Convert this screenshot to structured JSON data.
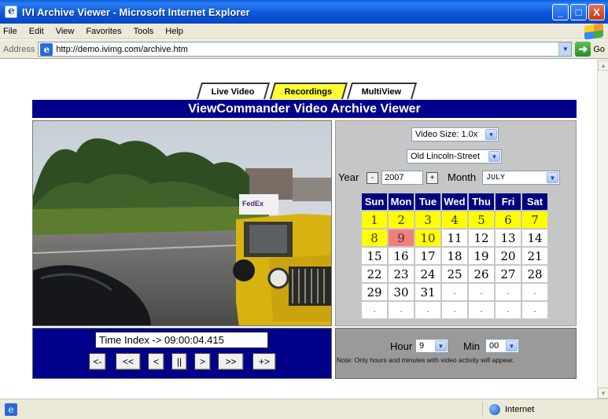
{
  "window": {
    "title": "IVI Archive Viewer - Microsoft Internet Explorer",
    "minimize_glyph": "_",
    "maximize_glyph": "□",
    "close_glyph": "X"
  },
  "menu": [
    "File",
    "Edit",
    "View",
    "Favorites",
    "Tools",
    "Help"
  ],
  "address": {
    "label": "Address",
    "url": "http://demo.ivimg.com/archive.htm",
    "go_label": "Go"
  },
  "status": {
    "zone": "Internet"
  },
  "tabs": [
    {
      "label": "Live Video",
      "active": false
    },
    {
      "label": "Recordings",
      "active": true
    },
    {
      "label": "MultiView",
      "active": false
    }
  ],
  "header": "ViewCommander Video Archive Viewer",
  "video": {
    "overlay_text": "FedEx"
  },
  "controls": {
    "video_size": "Video Size: 1.0x",
    "camera": "Old Lincoln-Street",
    "year_label": "Year",
    "year_minus": "-",
    "year_value": "2007",
    "year_plus": "+",
    "month_label": "Month",
    "month_value": "JULY"
  },
  "calendar": {
    "days": [
      "Sun",
      "Mon",
      "Tue",
      "Wed",
      "Thu",
      "Fri",
      "Sat"
    ],
    "weeks": [
      [
        "1",
        "2",
        "3",
        "4",
        "5",
        "6",
        "7"
      ],
      [
        "8",
        "9",
        "10",
        "11",
        "12",
        "13",
        "14"
      ],
      [
        "15",
        "16",
        "17",
        "18",
        "19",
        "20",
        "21"
      ],
      [
        "22",
        "23",
        "24",
        "25",
        "26",
        "27",
        "28"
      ],
      [
        "29",
        "30",
        "31",
        ".",
        ".",
        ".",
        "."
      ],
      [
        ".",
        ".",
        ".",
        ".",
        ".",
        ".",
        "."
      ]
    ],
    "recorded_days": [
      "1",
      "2",
      "3",
      "4",
      "5",
      "6",
      "7",
      "8",
      "10"
    ],
    "selected_day": "9",
    "highlight_color": "#ffff00",
    "selected_color": "#f08080"
  },
  "playback": {
    "time_index": "Time Index -> 09:00:04.415",
    "buttons": [
      "<-",
      "<<",
      "<",
      "||",
      ">",
      ">>",
      "+>"
    ]
  },
  "time_select": {
    "hour_label": "Hour",
    "hour_value": "9",
    "min_label": "Min",
    "min_value": "00",
    "note": "Note: Only hours and minutes with video activity will appear."
  },
  "colors": {
    "header_bg": "#00008b",
    "active_tab": "#ffff33",
    "panel_bg": "#c6c6c6"
  }
}
